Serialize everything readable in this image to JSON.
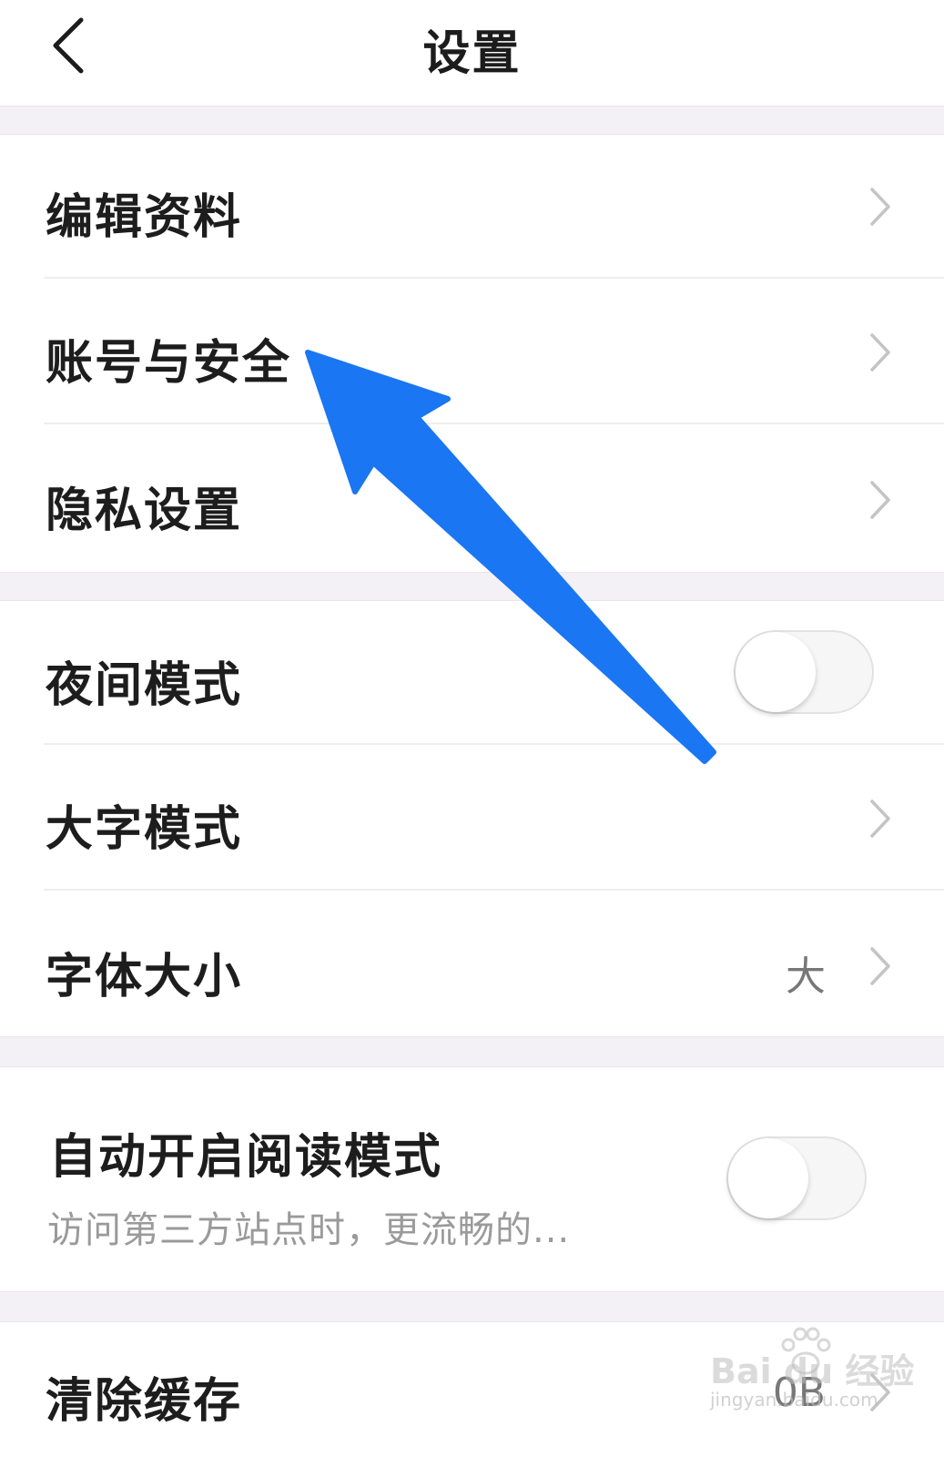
{
  "header": {
    "title": "设置"
  },
  "sections": [
    {
      "items": [
        {
          "label": "编辑资料",
          "control": "chevron"
        },
        {
          "label": "账号与安全",
          "control": "chevron"
        },
        {
          "label": "隐私设置",
          "control": "chevron"
        }
      ]
    },
    {
      "items": [
        {
          "label": "夜间模式",
          "control": "toggle",
          "enabled": false
        },
        {
          "label": "大字模式",
          "control": "chevron"
        },
        {
          "label": "字体大小",
          "value": "大",
          "control": "chevron"
        }
      ]
    },
    {
      "items": [
        {
          "label": "自动开启阅读模式",
          "subtitle": "访问第三方站点时，更流畅的...",
          "control": "toggle",
          "enabled": false
        }
      ]
    },
    {
      "items": [
        {
          "label": "清除缓存",
          "value": "0B",
          "control": "chevron"
        }
      ]
    }
  ],
  "annotation": {
    "type": "arrow",
    "color": "#1a76f2",
    "points_to": "账号与安全"
  },
  "watermark": {
    "brand": "Bai du 经验",
    "url": "jingyan.baidu.com"
  },
  "colors": {
    "separator": "#f3f1f5",
    "text": "#1d1d1d",
    "secondary_text": "#9a9a9a",
    "chevron": "#c4c4c4"
  }
}
